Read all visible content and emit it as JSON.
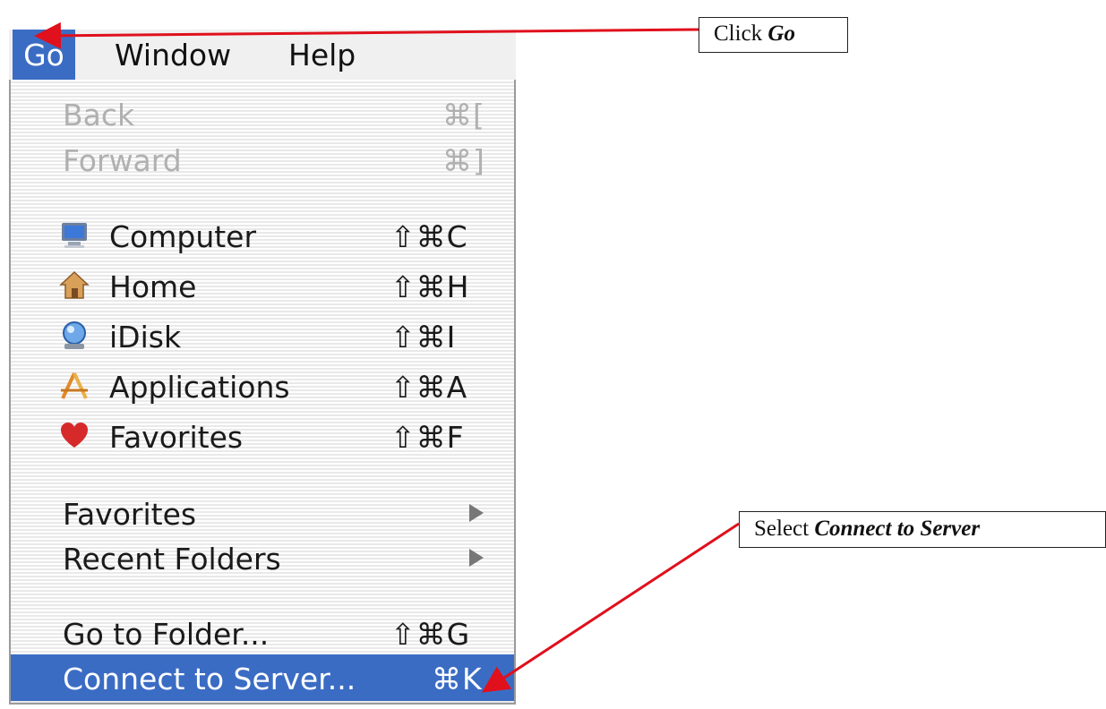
{
  "menubar": {
    "items": [
      "Go",
      "Window",
      "Help"
    ]
  },
  "menu": {
    "items": [
      {
        "label": "Back",
        "shortcut": "⌘[",
        "state": "disabled"
      },
      {
        "label": "Forward",
        "shortcut": "⌘]",
        "state": "disabled"
      },
      {
        "label": "Computer",
        "shortcut": "⇧⌘C",
        "icon": "computer-icon"
      },
      {
        "label": "Home",
        "shortcut": "⇧⌘H",
        "icon": "home-icon"
      },
      {
        "label": "iDisk",
        "shortcut": "⇧⌘I",
        "icon": "idisk-icon"
      },
      {
        "label": "Applications",
        "shortcut": "⇧⌘A",
        "icon": "applications-icon"
      },
      {
        "label": "Favorites",
        "shortcut": "⇧⌘F",
        "icon": "favorites-heart-icon"
      },
      {
        "label": "Favorites",
        "submenu": true
      },
      {
        "label": "Recent Folders",
        "submenu": true
      },
      {
        "label": "Go to Folder...",
        "shortcut": "⇧⌘G"
      },
      {
        "label": "Connect to Server...",
        "shortcut": "⌘K",
        "state": "selected"
      }
    ]
  },
  "callouts": {
    "go": {
      "prefix": "Click ",
      "emphasis": "Go"
    },
    "connect": {
      "prefix": "Select ",
      "emphasis": "Connect to Server"
    }
  },
  "colors": {
    "selection": "#3b6cc4",
    "arrow": "#e0101c"
  }
}
